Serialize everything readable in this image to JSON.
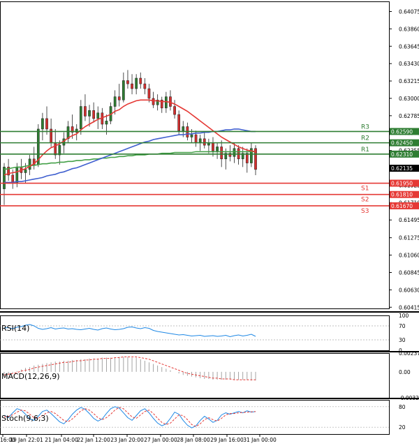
{
  "chart_data": {
    "type": "candlestick",
    "symbol_hint": "",
    "colors": {
      "up_candle": "#2e7d32",
      "down_candle": "#d32f2f",
      "ma_red": "#e53935",
      "ma_blue": "#3f5fcf",
      "ma_green": "#43a047",
      "resistance": "#2e7d32",
      "support": "#e53935",
      "indicator_line": "#1e88e5",
      "macd_signal": "#e53935",
      "stoch_k": "#1e88e5",
      "stoch_d": "#e53935",
      "last_price_box": "#000000"
    },
    "y_axis": {
      "min": 0.604,
      "max": 0.642,
      "tick_labels": [
        "0.64075",
        "0.63860",
        "0.63645",
        "0.63430",
        "0.63215",
        "0.63000",
        "0.62785",
        "0.62570",
        "0.62355",
        "0.62140",
        "0.61925",
        "0.61710",
        "0.61495",
        "0.61275",
        "0.61060",
        "0.60845",
        "0.60630",
        "0.60415"
      ]
    },
    "x_axis": {
      "labels": [
        "16:00",
        "19 Jan 22:01",
        "21 Jan 04:00",
        "22 Jan 12:00",
        "23 Jan 20:00",
        "27 Jan 00:00",
        "28 Jan 08:00",
        "29 Jan 16:00",
        "31 Jan 00:00"
      ]
    },
    "levels": [
      {
        "name": "R3",
        "value": 0.6259,
        "label": "0.62590",
        "kind": "resistance"
      },
      {
        "name": "R2",
        "value": 0.6245,
        "label": "0.62450",
        "kind": "resistance"
      },
      {
        "name": "R1",
        "value": 0.6231,
        "label": "0.62310",
        "kind": "resistance"
      },
      {
        "name": "S1",
        "value": 0.6195,
        "label": "0.61950",
        "kind": "support"
      },
      {
        "name": "S2",
        "value": 0.6181,
        "label": "0.61810",
        "kind": "support"
      },
      {
        "name": "S3",
        "value": 0.6167,
        "label": "0.61670",
        "kind": "support"
      }
    ],
    "last_price": {
      "value": 0.62135,
      "label": "0.62135"
    },
    "candles": [
      [
        0.6188,
        0.622,
        0.6168,
        0.6215
      ],
      [
        0.6215,
        0.6225,
        0.6198,
        0.6205
      ],
      [
        0.6205,
        0.6212,
        0.6188,
        0.6195
      ],
      [
        0.6195,
        0.622,
        0.619,
        0.6215
      ],
      [
        0.6215,
        0.6225,
        0.62,
        0.6208
      ],
      [
        0.6208,
        0.622,
        0.6195,
        0.6212
      ],
      [
        0.6212,
        0.623,
        0.6205,
        0.6225
      ],
      [
        0.6225,
        0.624,
        0.6212,
        0.6218
      ],
      [
        0.6218,
        0.6268,
        0.6215,
        0.6262
      ],
      [
        0.6262,
        0.6282,
        0.6248,
        0.6275
      ],
      [
        0.6275,
        0.629,
        0.6255,
        0.6262
      ],
      [
        0.6262,
        0.6275,
        0.624,
        0.6245
      ],
      [
        0.6245,
        0.6262,
        0.6225,
        0.623
      ],
      [
        0.623,
        0.6248,
        0.6218,
        0.6242
      ],
      [
        0.6242,
        0.6258,
        0.6232,
        0.625
      ],
      [
        0.625,
        0.6272,
        0.6245,
        0.6265
      ],
      [
        0.6265,
        0.628,
        0.625,
        0.6258
      ],
      [
        0.6258,
        0.6268,
        0.6248,
        0.6262
      ],
      [
        0.6262,
        0.6298,
        0.6255,
        0.629
      ],
      [
        0.629,
        0.6305,
        0.6272,
        0.6278
      ],
      [
        0.6278,
        0.6292,
        0.6265,
        0.6285
      ],
      [
        0.6285,
        0.6295,
        0.627,
        0.6275
      ],
      [
        0.6275,
        0.629,
        0.6262,
        0.6282
      ],
      [
        0.6282,
        0.6288,
        0.6262,
        0.6268
      ],
      [
        0.6268,
        0.628,
        0.6255,
        0.6272
      ],
      [
        0.6272,
        0.6295,
        0.6268,
        0.629
      ],
      [
        0.629,
        0.631,
        0.628,
        0.6302
      ],
      [
        0.6302,
        0.6318,
        0.629,
        0.6298
      ],
      [
        0.6298,
        0.6332,
        0.6295,
        0.6322
      ],
      [
        0.6322,
        0.6335,
        0.6312,
        0.6318
      ],
      [
        0.6318,
        0.633,
        0.6305,
        0.6312
      ],
      [
        0.6312,
        0.633,
        0.6305,
        0.6325
      ],
      [
        0.6325,
        0.6332,
        0.6312,
        0.6318
      ],
      [
        0.6318,
        0.6325,
        0.6305,
        0.6312
      ],
      [
        0.6312,
        0.6318,
        0.6295,
        0.63
      ],
      [
        0.63,
        0.6308,
        0.6288,
        0.6292
      ],
      [
        0.6292,
        0.6305,
        0.6285,
        0.6298
      ],
      [
        0.6298,
        0.6302,
        0.6282,
        0.6288
      ],
      [
        0.6288,
        0.6308,
        0.6282,
        0.6302
      ],
      [
        0.6302,
        0.631,
        0.6285,
        0.629
      ],
      [
        0.629,
        0.6298,
        0.6275,
        0.628
      ],
      [
        0.628,
        0.6285,
        0.6255,
        0.626
      ],
      [
        0.626,
        0.6272,
        0.6252,
        0.6265
      ],
      [
        0.6265,
        0.627,
        0.6248,
        0.6252
      ],
      [
        0.6252,
        0.6262,
        0.6245,
        0.6255
      ],
      [
        0.6255,
        0.626,
        0.624,
        0.6245
      ],
      [
        0.6245,
        0.6255,
        0.6235,
        0.625
      ],
      [
        0.625,
        0.6258,
        0.6238,
        0.6242
      ],
      [
        0.6242,
        0.625,
        0.6232,
        0.6245
      ],
      [
        0.6245,
        0.6252,
        0.6228,
        0.6235
      ],
      [
        0.6235,
        0.6245,
        0.6225,
        0.624
      ],
      [
        0.624,
        0.6248,
        0.6215,
        0.6225
      ],
      [
        0.6225,
        0.6238,
        0.6212,
        0.6232
      ],
      [
        0.6232,
        0.6242,
        0.6222,
        0.6228
      ],
      [
        0.6228,
        0.6245,
        0.622,
        0.6238
      ],
      [
        0.6238,
        0.6242,
        0.6218,
        0.6225
      ],
      [
        0.6225,
        0.624,
        0.6215,
        0.6232
      ],
      [
        0.6232,
        0.6238,
        0.6208,
        0.622
      ],
      [
        0.622,
        0.6245,
        0.6215,
        0.6238
      ],
      [
        0.6238,
        0.6242,
        0.6205,
        0.6212
      ]
    ],
    "ma_red": [
      0.6205,
      0.6207,
      0.6208,
      0.6209,
      0.6211,
      0.6213,
      0.6216,
      0.6219,
      0.6224,
      0.623,
      0.6235,
      0.6239,
      0.6241,
      0.6244,
      0.6247,
      0.6251,
      0.6254,
      0.6256,
      0.6261,
      0.6265,
      0.6268,
      0.6271,
      0.6274,
      0.6276,
      0.6278,
      0.628,
      0.6284,
      0.6286,
      0.629,
      0.6293,
      0.6295,
      0.6297,
      0.6298,
      0.6298,
      0.6298,
      0.6297,
      0.6297,
      0.6296,
      0.6296,
      0.6295,
      0.6293,
      0.629,
      0.6287,
      0.6284,
      0.628,
      0.6276,
      0.6272,
      0.6268,
      0.6264,
      0.626,
      0.6256,
      0.6252,
      0.6249,
      0.6246,
      0.6243,
      0.624,
      0.6238,
      0.6236,
      0.6235,
      0.6234
    ],
    "ma_blue": [
      0.6196,
      0.6196,
      0.6196,
      0.6197,
      0.6197,
      0.6198,
      0.6199,
      0.62,
      0.6201,
      0.6202,
      0.6204,
      0.6205,
      0.6206,
      0.6208,
      0.6209,
      0.6211,
      0.6213,
      0.6214,
      0.6216,
      0.6218,
      0.622,
      0.6222,
      0.6224,
      0.6226,
      0.6228,
      0.623,
      0.6232,
      0.6234,
      0.6236,
      0.6238,
      0.624,
      0.6242,
      0.6244,
      0.6246,
      0.6247,
      0.6249,
      0.625,
      0.6251,
      0.6252,
      0.6253,
      0.6254,
      0.6255,
      0.6255,
      0.6256,
      0.6256,
      0.6257,
      0.6257,
      0.6258,
      0.6258,
      0.6259,
      0.6259,
      0.626,
      0.6261,
      0.6261,
      0.6262,
      0.6262,
      0.6261,
      0.626,
      0.6259,
      0.6259
    ],
    "ma_green": [
      0.6212,
      0.6213,
      0.6214,
      0.6215,
      0.6215,
      0.6216,
      0.6217,
      0.6217,
      0.6218,
      0.6219,
      0.6219,
      0.622,
      0.622,
      0.6221,
      0.6221,
      0.6222,
      0.6222,
      0.6223,
      0.6223,
      0.6224,
      0.6224,
      0.6225,
      0.6225,
      0.6226,
      0.6226,
      0.6227,
      0.6227,
      0.6228,
      0.6228,
      0.6229,
      0.6229,
      0.623,
      0.623,
      0.623,
      0.6231,
      0.6231,
      0.6231,
      0.6232,
      0.6232,
      0.6232,
      0.6233,
      0.6233,
      0.6233,
      0.6233,
      0.6233,
      0.6234,
      0.6234,
      0.6234,
      0.6234,
      0.6234,
      0.6234,
      0.6234,
      0.6234,
      0.6234,
      0.6234,
      0.6234,
      0.6234,
      0.6234,
      0.6234,
      0.6234
    ],
    "rsi": {
      "label": "RSI(14)",
      "tick_labels": [
        "100",
        "70",
        "30",
        "0"
      ],
      "values": [
        64,
        65,
        62,
        66,
        68,
        72,
        74,
        70,
        63,
        60,
        62,
        65,
        61,
        63,
        64,
        61,
        62,
        60,
        59,
        61,
        63,
        60,
        58,
        62,
        64,
        61,
        59,
        60,
        62,
        66,
        67,
        64,
        62,
        65,
        63,
        57,
        54,
        52,
        50,
        48,
        46,
        44,
        45,
        43,
        41,
        42,
        43,
        40,
        41,
        42,
        40,
        41,
        43,
        39,
        42,
        44,
        41,
        43,
        46,
        40
      ]
    },
    "macd": {
      "label": "MACD(12,26,9)",
      "tick_labels": [
        "0.002376",
        "0.00",
        "-0.003286"
      ],
      "hist": [
        -0.0005,
        -0.0003,
        -0.0001,
        0.0001,
        0.0003,
        0.0005,
        0.0006,
        0.0008,
        0.0009,
        0.001,
        0.0011,
        0.0012,
        0.0013,
        0.0013,
        0.0014,
        0.0014,
        0.0015,
        0.0015,
        0.0016,
        0.0016,
        0.0017,
        0.0017,
        0.0017,
        0.0018,
        0.0018,
        0.0018,
        0.0018,
        0.0019,
        0.0019,
        0.0019,
        0.0018,
        0.0018,
        0.0016,
        0.0014,
        0.0012,
        0.001,
        0.0008,
        0.0006,
        0.0004,
        0.0002,
        0.0,
        -0.0002,
        -0.0004,
        -0.0005,
        -0.0006,
        -0.0007,
        -0.0008,
        -0.0009,
        -0.0009,
        -0.001,
        -0.001,
        -0.001,
        -0.001,
        -0.001,
        -0.001,
        -0.001,
        -0.001,
        -0.001,
        -0.0011,
        -0.0011
      ],
      "signal": [
        -0.0004,
        -0.0003,
        -0.0002,
        -0.0001,
        0.0001,
        0.0002,
        0.0003,
        0.0005,
        0.0006,
        0.0007,
        0.0008,
        0.0009,
        0.001,
        0.0011,
        0.0012,
        0.0012,
        0.0013,
        0.0014,
        0.0014,
        0.0015,
        0.0015,
        0.0016,
        0.0016,
        0.0017,
        0.0017,
        0.0017,
        0.0018,
        0.0018,
        0.0019,
        0.0019,
        0.0019,
        0.0019,
        0.0018,
        0.0017,
        0.0016,
        0.0014,
        0.0012,
        0.001,
        0.0008,
        0.0006,
        0.0004,
        0.0002,
        0.0,
        -0.0002,
        -0.0003,
        -0.0004,
        -0.0005,
        -0.0006,
        -0.0007,
        -0.0008,
        -0.0008,
        -0.0009,
        -0.0009,
        -0.0009,
        -0.001,
        -0.001,
        -0.001,
        -0.001,
        -0.001,
        -0.001
      ]
    },
    "stoch": {
      "label": "Stoch(9,6,3)",
      "tick_labels": [
        "80",
        "20"
      ],
      "k": [
        55,
        48,
        62,
        74,
        70,
        58,
        44,
        40,
        52,
        66,
        70,
        60,
        48,
        36,
        30,
        42,
        58,
        70,
        78,
        72,
        60,
        46,
        38,
        44,
        60,
        74,
        80,
        76,
        62,
        48,
        40,
        54,
        68,
        74,
        62,
        46,
        32,
        24,
        30,
        46,
        64,
        58,
        40,
        26,
        18,
        24,
        40,
        52,
        44,
        34,
        40,
        56,
        62,
        58,
        62,
        66,
        62,
        68,
        64,
        66
      ],
      "d": [
        50,
        52,
        56,
        64,
        70,
        68,
        58,
        48,
        46,
        54,
        62,
        66,
        60,
        50,
        40,
        36,
        44,
        56,
        68,
        74,
        70,
        60,
        48,
        42,
        48,
        58,
        70,
        78,
        74,
        62,
        50,
        46,
        56,
        66,
        70,
        60,
        46,
        34,
        28,
        32,
        44,
        56,
        54,
        42,
        28,
        22,
        30,
        42,
        48,
        42,
        38,
        46,
        56,
        60,
        60,
        62,
        63,
        64,
        65,
        66
      ]
    }
  }
}
